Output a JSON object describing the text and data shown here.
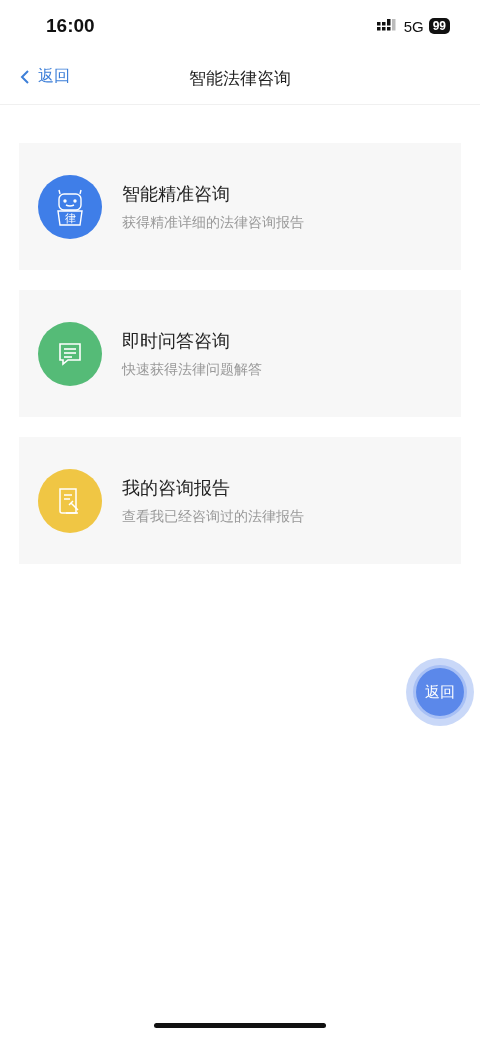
{
  "status_bar": {
    "time": "16:00",
    "network": "5G",
    "battery": "99"
  },
  "nav_bar": {
    "back": "返回",
    "title": "智能法律咨询"
  },
  "cards": [
    {
      "kind": "robot",
      "color": "#3f7ee8",
      "icon_text": "律",
      "title": "智能精准咨询",
      "subtitle": "获得精准详细的法律咨询报告"
    },
    {
      "kind": "chat",
      "color": "#55bb77",
      "title": "即时问答咨询",
      "subtitle": "快速获得法律问题解答"
    },
    {
      "kind": "report",
      "color": "#f0c644",
      "title": "我的咨询报告",
      "subtitle": "查看我已经咨询过的法律报告"
    }
  ],
  "float_button": {
    "label": "返回"
  }
}
